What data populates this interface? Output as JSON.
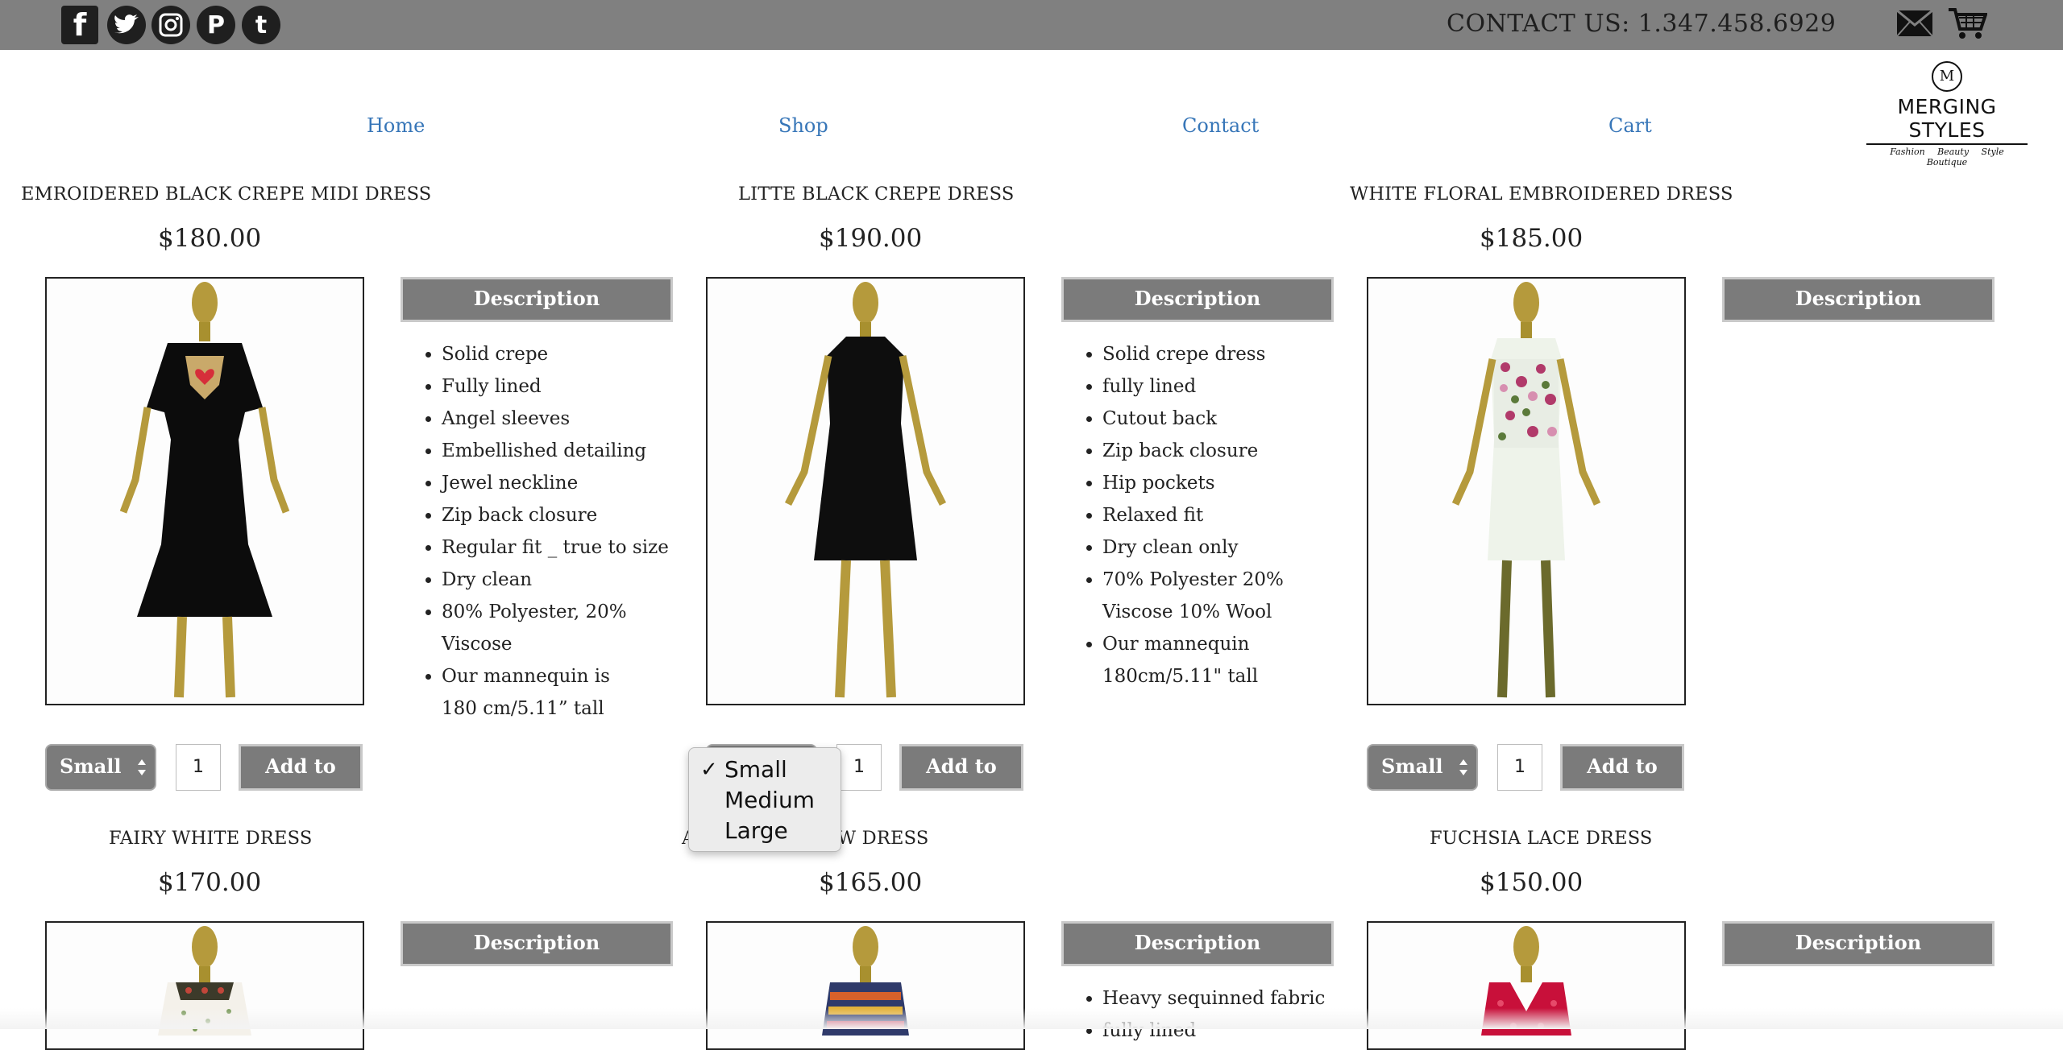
{
  "header": {
    "contact_text": "CONTACT US: 1.347.458.6929",
    "social_icons": [
      "facebook-icon",
      "twitter-icon",
      "instagram-icon",
      "pinterest-icon",
      "tumblr-icon"
    ],
    "social_glyphs": [
      "f",
      "t",
      "◎",
      "P",
      "t"
    ]
  },
  "nav": {
    "items": [
      "Home",
      "Shop",
      "Contact",
      "Cart"
    ]
  },
  "logo": {
    "mark": "M",
    "name": "MERGING STYLES",
    "tagline": "Fashion Beauty Style Boutique"
  },
  "common": {
    "description_label": "Description",
    "add_to_cart_label": "Add to Cart",
    "size_value": "Small",
    "qty_value": "1"
  },
  "products": [
    {
      "title": "EMROIDERED BLACK CREPE MIDI DRESS",
      "price": "$180.00",
      "details": [
        "Solid crepe",
        "Fully lined",
        "Angel sleeves",
        "Embellished detailing",
        "Jewel neckline",
        "Zip back closure",
        "Regular fit _ true to size",
        "Dry clean",
        "80% Polyester, 20% Viscose",
        "Our mannequin is 180 cm/5.11” tall"
      ]
    },
    {
      "title": "LITTE BLACK CREPE DRESS",
      "price": "$190.00",
      "details": [
        "Solid crepe dress",
        "fully lined",
        "Cutout back",
        "Zip back closure",
        "Hip pockets",
        "Relaxed fit",
        "Dry clean only",
        "70% Polyester 20% Viscose 10% Wool",
        "Our mannequin 180cm/5.11\" tall"
      ]
    },
    {
      "title": "WHITE FLORAL EMBROIDERED DRESS",
      "price": "$185.00",
      "details": []
    },
    {
      "title": "FAIRY WHITE DRESS",
      "price": "$170.00",
      "details": []
    },
    {
      "title": "A    ARTY RAINBOW DRESS",
      "price": "$165.00",
      "details": [
        "Heavy sequinned fabric",
        "fully lined"
      ]
    },
    {
      "title": "FUCHSIA LACE DRESS",
      "price": "$150.00",
      "details": []
    }
  ],
  "dropdown": {
    "options": [
      "Small",
      "Medium",
      "Large"
    ],
    "selected": "Small",
    "check": "✓"
  },
  "colors": {
    "topbar": "#808080",
    "button": "#7b7b7b",
    "nav_link": "#3776b8"
  }
}
